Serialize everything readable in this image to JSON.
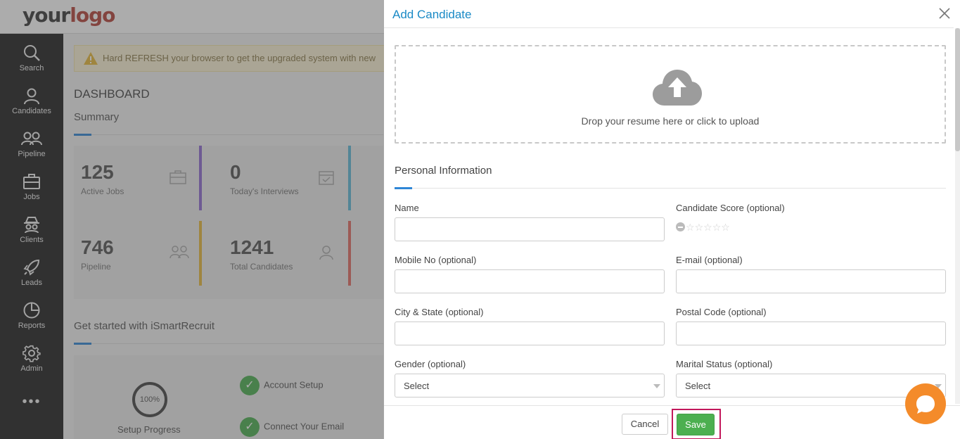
{
  "app": {
    "logo_part1": "your",
    "logo_part2": "logo"
  },
  "sidebar": {
    "items": [
      {
        "label": "Search",
        "icon": "search-icon"
      },
      {
        "label": "Candidates",
        "icon": "person-icon"
      },
      {
        "label": "Pipeline",
        "icon": "people-icon"
      },
      {
        "label": "Jobs",
        "icon": "briefcase-icon"
      },
      {
        "label": "Clients",
        "icon": "spy-icon"
      },
      {
        "label": "Leads",
        "icon": "rocket-icon"
      },
      {
        "label": "Reports",
        "icon": "pie-chart-icon"
      },
      {
        "label": "Admin",
        "icon": "gear-icon"
      }
    ],
    "more_label": "•••"
  },
  "dashboard": {
    "alert_text": "Hard REFRESH your browser to get the upgraded system with new",
    "title": "DASHBOARD",
    "summary_title": "Summary",
    "stats": [
      {
        "value": "125",
        "label": "Active Jobs",
        "color": "#8e6bd1"
      },
      {
        "value": "0",
        "label": "Today's Interviews",
        "color": "#5bb8d8"
      },
      {
        "value": "746",
        "label": "Pipeline",
        "color": "#e8b93a"
      },
      {
        "value": "1241",
        "label": "Total Candidates",
        "color": "#e26a62"
      }
    ],
    "getting_started_title": "Get started with iSmartRecruit",
    "setup_progress_value": "100%",
    "setup_progress_label": "Setup Progress",
    "setup_steps": [
      "Account Setup",
      "Connect Your Email"
    ]
  },
  "modal": {
    "title": "Add Candidate",
    "dropzone_text": "Drop your resume here or click to upload",
    "section_title": "Personal Information",
    "fields": {
      "name_label": "Name",
      "score_label": "Candidate Score (optional)",
      "score_value": 0,
      "score_max": 5,
      "mobile_label": "Mobile No (optional)",
      "email_label": "E-mail (optional)",
      "city_label": "City & State (optional)",
      "postal_label": "Postal Code (optional)",
      "gender_label": "Gender (optional)",
      "gender_value": "Select",
      "marital_label": "Marital Status (optional)",
      "marital_value": "Select"
    },
    "cancel_label": "Cancel",
    "save_label": "Save"
  },
  "colors": {
    "accent": "#1a8ac6",
    "save": "#4caf50",
    "highlight": "#c2185b",
    "chat": "#f48b2a"
  }
}
